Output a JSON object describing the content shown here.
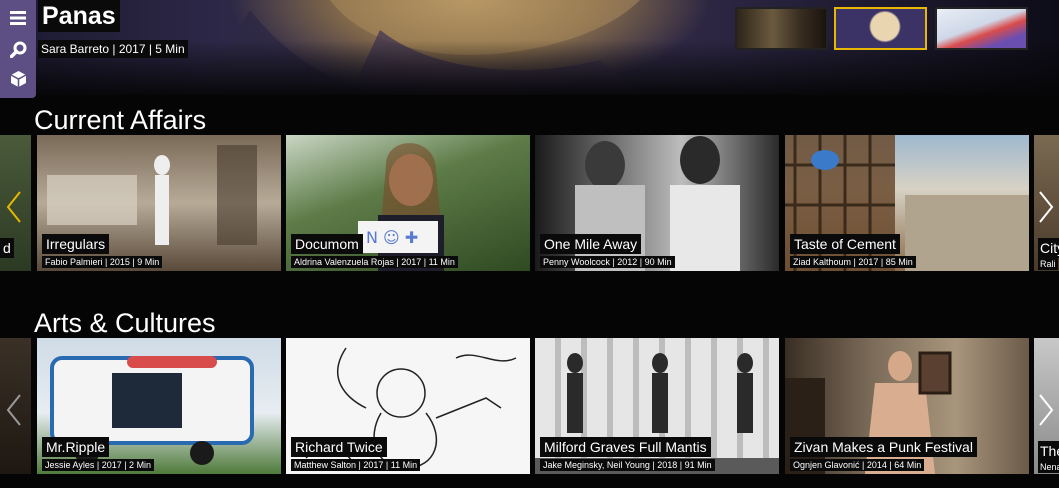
{
  "featured": {
    "title": "Panas",
    "meta": "Sara Barreto | 2017 | 5 Min",
    "thumbnails": [
      {
        "name": "thumb-1",
        "selected": false,
        "color": "#5b4a36"
      },
      {
        "name": "thumb-2",
        "selected": true,
        "color": "#3b3266"
      },
      {
        "name": "thumb-3",
        "selected": false,
        "color": "#d9e2ee"
      }
    ]
  },
  "sidebar": {
    "items": [
      {
        "icon": "menu-icon"
      },
      {
        "icon": "search-icon"
      },
      {
        "icon": "box-icon"
      }
    ]
  },
  "sections": [
    {
      "title": "Current Affairs",
      "left_partial": {
        "title": "d"
      },
      "right_partial": {
        "title": "City",
        "meta": "Rali"
      },
      "cards": [
        {
          "title": "Irregulars",
          "meta": "Fabio Palmieri | 2015 | 9 Min",
          "color1": "#6b5a45",
          "color2": "#c9c2b5"
        },
        {
          "title": "Documom",
          "meta": "Aldrina Valenzuela Rojas | 2017 | 11 Min",
          "color1": "#3f5a2a",
          "color2": "#a7c07a"
        },
        {
          "title": "One Mile Away",
          "meta": "Penny Woolcock | 2012 | 90 Min",
          "color1": "#2a2a2a",
          "color2": "#9a9a9a"
        },
        {
          "title": "Taste of Cement",
          "meta": "Ziad Kalthoum | 2017 | 85 Min",
          "color1": "#6d4a2e",
          "color2": "#cfc1a3"
        }
      ]
    },
    {
      "title": "Arts & Cultures",
      "left_partial": {
        "title": ""
      },
      "right_partial": {
        "title": "The",
        "meta": "Nena"
      },
      "cards": [
        {
          "title": "Mr.Ripple",
          "meta": "Jessie Ayles | 2017 | 2 Min",
          "color1": "#4f7a3a",
          "color2": "#d7e3ee"
        },
        {
          "title": "Richard Twice",
          "meta": "Matthew Salton | 2017 | 11 Min",
          "color1": "#f4f4f4",
          "color2": "#cfcfcf"
        },
        {
          "title": "Milford Graves Full Mantis",
          "meta": "Jake Meginsky, Neil Young | 2018 | 91 Min",
          "color1": "#3a3a3a",
          "color2": "#d2d2d2"
        },
        {
          "title": "Zivan Makes a Punk Festival",
          "meta": "Ognjen Glavonić | 2014 | 64 Min",
          "color1": "#4e3e2e",
          "color2": "#b09a80"
        }
      ]
    }
  ]
}
